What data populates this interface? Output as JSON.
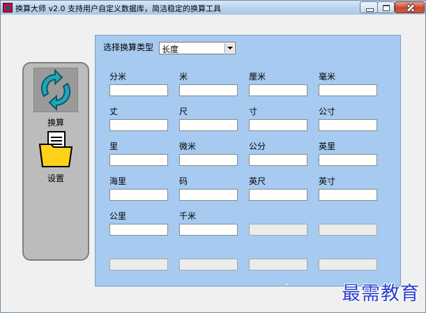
{
  "window": {
    "title": "换算大师 v2.0 支持用户自定义数据库，简洁稳定的换算工具"
  },
  "sidebar": {
    "items": [
      {
        "label": "换算",
        "icon": "convert-icon"
      },
      {
        "label": "设置",
        "icon": "folder-document-icon"
      }
    ]
  },
  "converter": {
    "type_label": "选择换算类型",
    "type_value": "长度",
    "units": [
      {
        "label": "分米",
        "value": ""
      },
      {
        "label": "米",
        "value": ""
      },
      {
        "label": "厘米",
        "value": ""
      },
      {
        "label": "毫米",
        "value": ""
      },
      {
        "label": "丈",
        "value": ""
      },
      {
        "label": "尺",
        "value": ""
      },
      {
        "label": "寸",
        "value": ""
      },
      {
        "label": "公寸",
        "value": ""
      },
      {
        "label": "里",
        "value": ""
      },
      {
        "label": "微米",
        "value": ""
      },
      {
        "label": "公分",
        "value": ""
      },
      {
        "label": "英里",
        "value": ""
      },
      {
        "label": "海里",
        "value": ""
      },
      {
        "label": "码",
        "value": ""
      },
      {
        "label": "英尺",
        "value": ""
      },
      {
        "label": "英寸",
        "value": ""
      },
      {
        "label": "公里",
        "value": ""
      },
      {
        "label": "千米",
        "value": ""
      }
    ]
  },
  "watermark": "最需教育",
  "colors": {
    "panel": "#a6caf0",
    "sidebar": "#bcbcbc",
    "watermark": "#2a3fd0"
  }
}
